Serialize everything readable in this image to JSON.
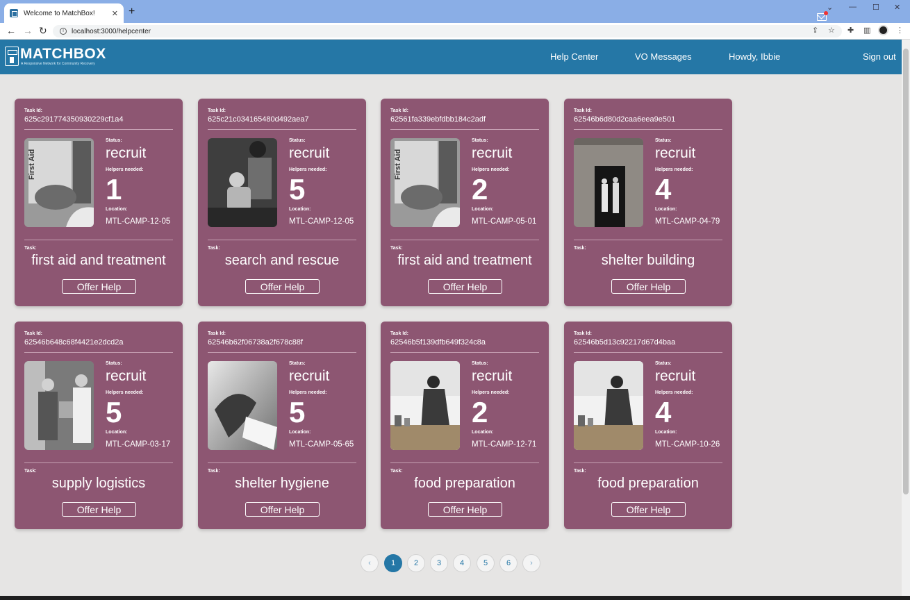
{
  "browser": {
    "tab_title": "Welcome to MatchBox!",
    "url": "localhost:3000/helpcenter"
  },
  "header": {
    "logo_text": "MATCHBOX",
    "logo_tagline": "A Responsive Network for Community Recovery",
    "nav": {
      "help_center": "Help Center",
      "vo_messages": "VO Messages",
      "greeting": "Howdy, Ibbie",
      "sign_out": "Sign out"
    }
  },
  "labels": {
    "task_id": "Task Id:",
    "status": "Status:",
    "helpers": "Helpers needed:",
    "location": "Location:",
    "task": "Task:",
    "offer": "Offer Help"
  },
  "cards": [
    {
      "id": "625c291774350930229cf1a4",
      "status": "recruit",
      "helpers": "1",
      "location": "MTL-CAMP-12-05",
      "task": "first aid and treatment",
      "image": "first-aid-kit"
    },
    {
      "id": "625c21c034165480d492aea7",
      "status": "recruit",
      "helpers": "5",
      "location": "MTL-CAMP-12-05",
      "task": "search and rescue",
      "image": "rescuer-with-child"
    },
    {
      "id": "62561fa339ebfdbb184c2adf",
      "status": "recruit",
      "helpers": "2",
      "location": "MTL-CAMP-05-01",
      "task": "first aid and treatment",
      "image": "first-aid-kit"
    },
    {
      "id": "62546b6d80d2caa6eea9e501",
      "status": "recruit",
      "helpers": "4",
      "location": "MTL-CAMP-04-79",
      "task": "shelter building",
      "image": "shelter-doorway"
    },
    {
      "id": "62546b648c68f4421e2dcd2a",
      "status": "recruit",
      "helpers": "5",
      "location": "MTL-CAMP-03-17",
      "task": "supply logistics",
      "image": "supply-handover"
    },
    {
      "id": "62546b62f06738a2f678c88f",
      "status": "recruit",
      "helpers": "5",
      "location": "MTL-CAMP-05-65",
      "task": "shelter hygiene",
      "image": "gloved-hand"
    },
    {
      "id": "62546b5f139dfb649f324c8a",
      "status": "recruit",
      "helpers": "2",
      "location": "MTL-CAMP-12-71",
      "task": "food preparation",
      "image": "kitchen-worker"
    },
    {
      "id": "62546b5d13c92217d67d4baa",
      "status": "recruit",
      "helpers": "4",
      "location": "MTL-CAMP-10-26",
      "task": "food preparation",
      "image": "kitchen-worker"
    }
  ],
  "pagination": {
    "prev": "‹",
    "next": "›",
    "pages": [
      "1",
      "2",
      "3",
      "4",
      "5",
      "6"
    ],
    "current": "1"
  }
}
